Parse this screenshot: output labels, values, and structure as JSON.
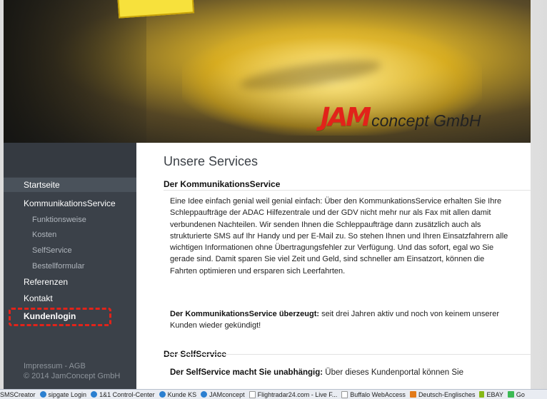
{
  "colors": {
    "sidebar_bg": "#3b4149",
    "accent_red": "#e2231a",
    "highlight_dash": "#e2231a"
  },
  "header": {
    "logo_jam": "JAM",
    "logo_concept": "concept GmbH"
  },
  "nav": {
    "items": [
      {
        "label": "Startseite"
      },
      {
        "label": "KommunikationsService"
      },
      {
        "label": "Funktionsweise"
      },
      {
        "label": "Kosten"
      },
      {
        "label": "SelfService"
      },
      {
        "label": "Bestellformular"
      },
      {
        "label": "Referenzen"
      },
      {
        "label": "Kontakt"
      },
      {
        "label": "Kundenlogin"
      }
    ],
    "footer_line1": "Impressum - AGB",
    "footer_line2": "© 2014 JamConcept GmbH"
  },
  "main": {
    "title": "Unsere Services",
    "sections": [
      {
        "heading": "Der KommunikationsService",
        "para1": "Eine Idee einfach genial weil genial einfach: Über den KommunkationsService erhalten Sie Ihre Schleppaufträge der ADAC Hilfezentrale und der GDV nicht mehr nur als Fax mit allen damit verbundenen Nachteilen. Wir senden Ihnen die Schleppaufträge dann zusätzlich auch als strukturierte SMS auf Ihr Handy und per E-Mail zu. So stehen Ihnen und Ihren Einsatzfahrern alle wichtigen Informationen ohne Übertragungsfehler zur Verfügung. Und das sofort, egal wo Sie gerade sind. Damit sparen Sie viel Zeit und Geld, sind schneller am Einsatzort, können die Fahrten optimieren und ersparen sich Leerfahrten.",
        "para2_bold": "Der KommunikationsService überzeugt:",
        "para2_text": " seit drei Jahren aktiv und noch von keinem unserer Kunden wieder gekündigt!"
      },
      {
        "heading": "Der SelfService",
        "para1_bold": "Der SelfService macht Sie unabhängig:",
        "para1_text": " Über dieses Kundenportal können Sie"
      }
    ]
  },
  "taskbar": {
    "items": [
      {
        "label": "SMSCreator",
        "icon": "sms-icon"
      },
      {
        "label": "sipgate Login",
        "icon": "globe-icon"
      },
      {
        "label": "1&1 Control-Center",
        "icon": "globe-icon"
      },
      {
        "label": "Kunde KS",
        "icon": "globe-icon"
      },
      {
        "label": "JAMconcept",
        "icon": "globe-icon"
      },
      {
        "label": "Flightradar24.com - Live F...",
        "icon": "page-icon"
      },
      {
        "label": "Buffalo WebAccess",
        "icon": "page-icon"
      },
      {
        "label": "Deutsch-Englisches",
        "icon": "dict-icon"
      },
      {
        "label": "EBAY",
        "icon": "ebay-icon"
      },
      {
        "label": "Go",
        "icon": "google-icon"
      }
    ]
  }
}
